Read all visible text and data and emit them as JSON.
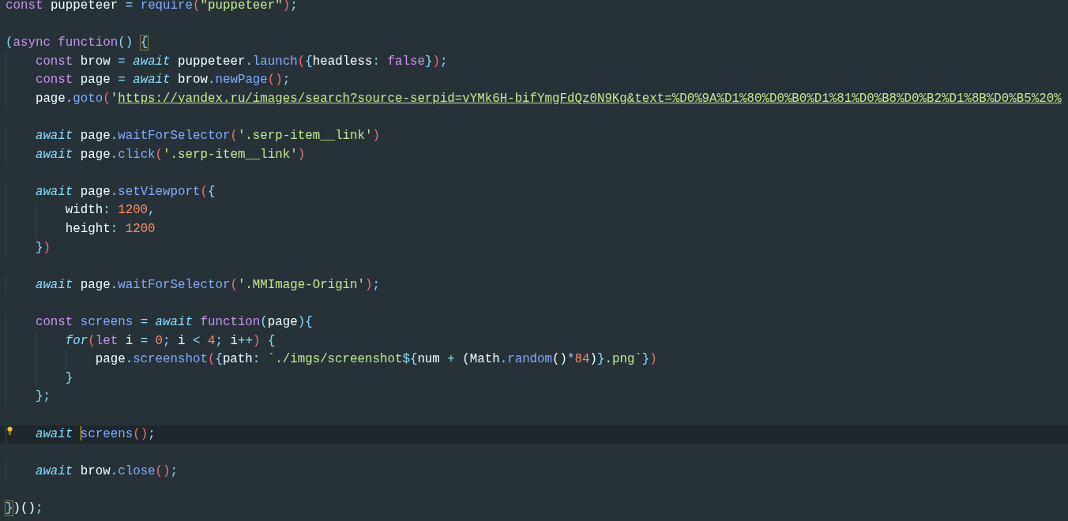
{
  "editor": {
    "blocks": [
      [
        {
          "current": false,
          "tokens": [
            {
              "text": "const",
              "kind": "keyword"
            },
            {
              "text": " puppeteer ",
              "kind": "plain"
            },
            {
              "text": "=",
              "kind": "punct"
            },
            {
              "text": " require",
              "kind": "func"
            },
            {
              "text": "(",
              "kind": "paren"
            },
            {
              "text": "\"puppeteer\"",
              "kind": "string"
            },
            {
              "text": ")",
              "kind": "paren"
            },
            {
              "text": ";",
              "kind": "punct"
            }
          ]
        }
      ],
      [
        {
          "current": false,
          "tokens": [
            {
              "text": "(",
              "kind": "punct"
            },
            {
              "text": "async",
              "kind": "keyword"
            },
            {
              "text": " function",
              "kind": "keyword"
            },
            {
              "text": "() ",
              "kind": "punct"
            },
            {
              "text": "{",
              "kind": "bracket_match"
            }
          ]
        },
        {
          "current": false,
          "tokens": [
            {
              "text": "    const",
              "kind": "keyword"
            },
            {
              "text": " brow ",
              "kind": "plain"
            },
            {
              "text": "=",
              "kind": "punct"
            },
            {
              "text": " await",
              "kind": "await"
            },
            {
              "text": " puppeteer",
              "kind": "plain"
            },
            {
              "text": ".",
              "kind": "punct"
            },
            {
              "text": "launch",
              "kind": "func"
            },
            {
              "text": "(",
              "kind": "paren"
            },
            {
              "text": "{",
              "kind": "punct"
            },
            {
              "text": "headless",
              "kind": "plain"
            },
            {
              "text": ":",
              "kind": "punct"
            },
            {
              "text": " false",
              "kind": "keyword"
            },
            {
              "text": "}",
              "kind": "punct"
            },
            {
              "text": ")",
              "kind": "paren"
            },
            {
              "text": ";",
              "kind": "punct"
            }
          ]
        },
        {
          "current": false,
          "tokens": [
            {
              "text": "    const",
              "kind": "keyword"
            },
            {
              "text": " page ",
              "kind": "plain"
            },
            {
              "text": "=",
              "kind": "punct"
            },
            {
              "text": " await",
              "kind": "await"
            },
            {
              "text": " brow",
              "kind": "plain"
            },
            {
              "text": ".",
              "kind": "punct"
            },
            {
              "text": "newPage",
              "kind": "func"
            },
            {
              "text": "()",
              "kind": "paren"
            },
            {
              "text": ";",
              "kind": "punct"
            }
          ]
        },
        {
          "current": false,
          "tokens": [
            {
              "text": "    page",
              "kind": "plain"
            },
            {
              "text": ".",
              "kind": "punct"
            },
            {
              "text": "goto",
              "kind": "func"
            },
            {
              "text": "(",
              "kind": "paren"
            },
            {
              "text": "'",
              "kind": "string"
            },
            {
              "text": "https://yandex.ru/images/search?source-serpid=vYMk6H-bifYmgFdQz0N9Kg&text=%D0%9A%D1%80%D0%B0%D1%81%D0%B8%D0%B2%D1%8B%D0%B5%20%",
              "kind": "url"
            }
          ]
        }
      ],
      [
        {
          "current": false,
          "tokens": [
            {
              "text": "    await",
              "kind": "await"
            },
            {
              "text": " page",
              "kind": "plain"
            },
            {
              "text": ".",
              "kind": "punct"
            },
            {
              "text": "waitForSelector",
              "kind": "func"
            },
            {
              "text": "(",
              "kind": "paren"
            },
            {
              "text": "'.serp-item__link'",
              "kind": "string"
            },
            {
              "text": ")",
              "kind": "paren"
            }
          ]
        },
        {
          "current": false,
          "tokens": [
            {
              "text": "    await",
              "kind": "await"
            },
            {
              "text": " page",
              "kind": "plain"
            },
            {
              "text": ".",
              "kind": "punct"
            },
            {
              "text": "click",
              "kind": "func"
            },
            {
              "text": "(",
              "kind": "paren"
            },
            {
              "text": "'.serp-item__link'",
              "kind": "string"
            },
            {
              "text": ")",
              "kind": "paren"
            }
          ]
        }
      ],
      [
        {
          "current": false,
          "tokens": [
            {
              "text": "    await",
              "kind": "await"
            },
            {
              "text": " page",
              "kind": "plain"
            },
            {
              "text": ".",
              "kind": "punct"
            },
            {
              "text": "setViewport",
              "kind": "func"
            },
            {
              "text": "(",
              "kind": "paren"
            },
            {
              "text": "{",
              "kind": "punct"
            }
          ]
        },
        {
          "current": false,
          "tokens": [
            {
              "text": "        width",
              "kind": "plain"
            },
            {
              "text": ":",
              "kind": "punct"
            },
            {
              "text": " 1200",
              "kind": "number"
            },
            {
              "text": ",",
              "kind": "punct"
            }
          ]
        },
        {
          "current": false,
          "tokens": [
            {
              "text": "        height",
              "kind": "plain"
            },
            {
              "text": ":",
              "kind": "punct"
            },
            {
              "text": " 1200",
              "kind": "number"
            }
          ]
        },
        {
          "current": false,
          "tokens": [
            {
              "text": "    }",
              "kind": "punct"
            },
            {
              "text": ")",
              "kind": "paren"
            }
          ]
        }
      ],
      [
        {
          "current": false,
          "tokens": [
            {
              "text": "    await",
              "kind": "await"
            },
            {
              "text": " page",
              "kind": "plain"
            },
            {
              "text": ".",
              "kind": "punct"
            },
            {
              "text": "waitForSelector",
              "kind": "func"
            },
            {
              "text": "(",
              "kind": "paren"
            },
            {
              "text": "'.MMImage-Origin'",
              "kind": "string"
            },
            {
              "text": ")",
              "kind": "paren"
            },
            {
              "text": ";",
              "kind": "punct"
            }
          ]
        }
      ],
      [
        {
          "current": false,
          "tokens": [
            {
              "text": "    const",
              "kind": "keyword"
            },
            {
              "text": " screens ",
              "kind": "func"
            },
            {
              "text": "=",
              "kind": "punct"
            },
            {
              "text": " await",
              "kind": "await"
            },
            {
              "text": " function",
              "kind": "keyword"
            },
            {
              "text": "(",
              "kind": "punct"
            },
            {
              "text": "page",
              "kind": "plain"
            },
            {
              "text": ")",
              "kind": "punct"
            },
            {
              "text": "{",
              "kind": "punct"
            }
          ]
        },
        {
          "current": false,
          "tokens": [
            {
              "text": "        for",
              "kind": "await"
            },
            {
              "text": "(",
              "kind": "paren"
            },
            {
              "text": "let",
              "kind": "keyword"
            },
            {
              "text": " i ",
              "kind": "plain"
            },
            {
              "text": "=",
              "kind": "punct"
            },
            {
              "text": " 0",
              "kind": "number"
            },
            {
              "text": ";",
              "kind": "punct"
            },
            {
              "text": " i ",
              "kind": "plain"
            },
            {
              "text": "<",
              "kind": "punct"
            },
            {
              "text": " 4",
              "kind": "number"
            },
            {
              "text": ";",
              "kind": "punct"
            },
            {
              "text": " i",
              "kind": "plain"
            },
            {
              "text": "++",
              "kind": "punct"
            },
            {
              "text": ")",
              "kind": "paren"
            },
            {
              "text": " {",
              "kind": "punct"
            }
          ]
        },
        {
          "current": false,
          "tokens": [
            {
              "text": "            page",
              "kind": "plain"
            },
            {
              "text": ".",
              "kind": "punct"
            },
            {
              "text": "screenshot",
              "kind": "func"
            },
            {
              "text": "(",
              "kind": "paren"
            },
            {
              "text": "{",
              "kind": "punct"
            },
            {
              "text": "path",
              "kind": "plain"
            },
            {
              "text": ":",
              "kind": "punct"
            },
            {
              "text": " `./imgs/screenshot",
              "kind": "string"
            },
            {
              "text": "${",
              "kind": "punct"
            },
            {
              "text": "num ",
              "kind": "plain"
            },
            {
              "text": "+",
              "kind": "punct"
            },
            {
              "text": " (Math",
              "kind": "plain"
            },
            {
              "text": ".",
              "kind": "punct"
            },
            {
              "text": "random",
              "kind": "func"
            },
            {
              "text": "()",
              "kind": "plain"
            },
            {
              "text": "*",
              "kind": "punct"
            },
            {
              "text": "84",
              "kind": "number"
            },
            {
              "text": ")",
              "kind": "plain"
            },
            {
              "text": "}",
              "kind": "punct"
            },
            {
              "text": ".png`",
              "kind": "string"
            },
            {
              "text": "}",
              "kind": "punct"
            },
            {
              "text": ")",
              "kind": "paren"
            }
          ]
        },
        {
          "current": false,
          "tokens": [
            {
              "text": "        }",
              "kind": "punct"
            }
          ]
        },
        {
          "current": false,
          "tokens": [
            {
              "text": "    };",
              "kind": "punct"
            }
          ]
        }
      ],
      [
        {
          "current": true,
          "tokens": [
            {
              "text": "    await ",
              "kind": "await"
            },
            {
              "text": "screens",
              "kind": "func"
            },
            {
              "text": "()",
              "kind": "paren"
            },
            {
              "text": ";",
              "kind": "punct"
            }
          ]
        }
      ],
      [
        {
          "current": false,
          "tokens": [
            {
              "text": "    await",
              "kind": "await"
            },
            {
              "text": " brow",
              "kind": "plain"
            },
            {
              "text": ".",
              "kind": "punct"
            },
            {
              "text": "close",
              "kind": "func"
            },
            {
              "text": "()",
              "kind": "paren"
            },
            {
              "text": ";",
              "kind": "punct"
            }
          ]
        }
      ],
      [
        {
          "current": false,
          "tokens": [
            {
              "text": "}",
              "kind": "bracket_match"
            },
            {
              "text": ")()",
              "kind": "plain"
            },
            {
              "text": ";",
              "kind": "punct"
            }
          ]
        }
      ]
    ]
  }
}
